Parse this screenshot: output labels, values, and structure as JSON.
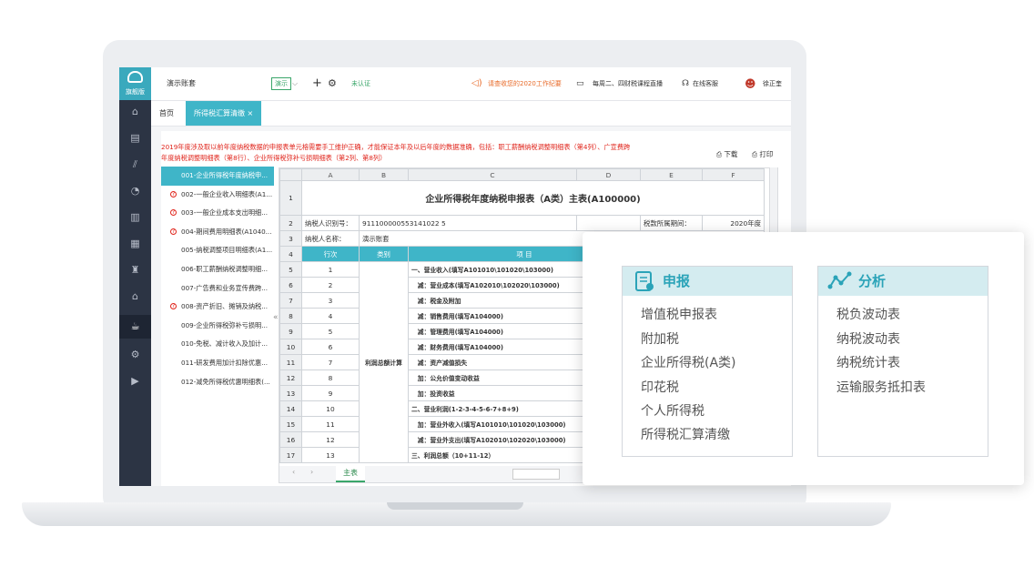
{
  "app": {
    "logo_label": "旗舰版",
    "account": "演示账套",
    "env_badge": "演示",
    "status": "未认证"
  },
  "header": {
    "notice": "请查收您的2020工作纪要",
    "live": "每周二、四财税课程直播",
    "service": "在线客服",
    "user": "徐正奎"
  },
  "tabs": [
    {
      "label": "首页"
    },
    {
      "label": "所得税汇算清缴 ×"
    }
  ],
  "notice_text": "2019年度涉及取以前年度纳税数据的申报表单元格需要手工维护正确，才能保证本年及以后年度的数据准确，包括：职工薪酬纳税调整明细表（第4列）、广宣费跨年度纳税调整明细表（第8行）、企业所得税弥补亏损明细表（第2列、第8列）",
  "toolbar": {
    "download": "下载",
    "print": "打印"
  },
  "report_list": [
    {
      "label": "001-企业所得税年度纳税申...",
      "warn": false
    },
    {
      "label": "002-一般企业收入明细表(A1...",
      "warn": true
    },
    {
      "label": "003-一般企业成本支出明细...",
      "warn": true
    },
    {
      "label": "004-期间费用明细表(A1040...",
      "warn": true
    },
    {
      "label": "005-纳税调整项目明细表(A1...",
      "warn": false
    },
    {
      "label": "006-职工薪酬纳税调整明细...",
      "warn": false
    },
    {
      "label": "007-广告费和业务宣传费跨...",
      "warn": false
    },
    {
      "label": "008-资产折旧、摊销及纳税...",
      "warn": true
    },
    {
      "label": "009-企业所得税弥补亏损明...",
      "warn": false
    },
    {
      "label": "010-免税、减计收入及加计...",
      "warn": false
    },
    {
      "label": "011-研发费用加计扣除优惠...",
      "warn": false
    },
    {
      "label": "012-减免所得税优惠明细表(...",
      "warn": false
    }
  ],
  "sheet": {
    "col_headers": [
      "A",
      "B",
      "C",
      "D",
      "E",
      "F"
    ],
    "title": "企业所得税年度纳税申报表（A类）主表(A100000)",
    "taxpayer_id_label": "纳税人识别号：",
    "taxpayer_id": "911100000553141022 5",
    "period_label": "税款所属期间：",
    "period": "2020年度",
    "taxpayer_name_label": "纳税人名称：",
    "taxpayer_name": "演示账套",
    "table_headers": [
      "行次",
      "类别",
      "项 目"
    ],
    "category": "利润总额计算",
    "rows": [
      {
        "n": "5",
        "seq": "1",
        "item": "一、营业收入(填写A101010\\101020\\103000)"
      },
      {
        "n": "6",
        "seq": "2",
        "item": "　减：营业成本(填写A102010\\102020\\103000)"
      },
      {
        "n": "7",
        "seq": "3",
        "item": "　减：税金及附加"
      },
      {
        "n": "8",
        "seq": "4",
        "item": "　减：销售费用(填写A104000)"
      },
      {
        "n": "9",
        "seq": "5",
        "item": "　减：管理费用(填写A104000)"
      },
      {
        "n": "10",
        "seq": "6",
        "item": "　减：财务费用(填写A104000)"
      },
      {
        "n": "11",
        "seq": "7",
        "item": "　减：资产减值损失"
      },
      {
        "n": "12",
        "seq": "8",
        "item": "　加：公允价值变动收益"
      },
      {
        "n": "13",
        "seq": "9",
        "item": "　加：投资收益"
      },
      {
        "n": "14",
        "seq": "10",
        "item": "二、营业利润(1-2-3-4-5-6-7+8+9)"
      },
      {
        "n": "15",
        "seq": "11",
        "item": "　加：营业外收入(填写A101010\\101020\\103000)"
      },
      {
        "n": "16",
        "seq": "12",
        "item": "　减：营业外支出(填写A102010\\102020\\103000)"
      },
      {
        "n": "17",
        "seq": "13",
        "item": "三、利润总额（10+11-12）"
      }
    ],
    "sheet_tab": "主表"
  },
  "popup": {
    "declare": {
      "title": "申报",
      "items": [
        "增值税申报表",
        "附加税",
        "企业所得税(A类)",
        "印花税",
        "个人所得税",
        "所得税汇算清缴"
      ]
    },
    "analysis": {
      "title": "分析",
      "items": [
        "税负波动表",
        "纳税波动表",
        "纳税统计表",
        "运输服务抵扣表"
      ]
    }
  },
  "colors": {
    "accent": "#3fb5c8",
    "nav": "#2c3444",
    "warn": "#e0241b"
  }
}
